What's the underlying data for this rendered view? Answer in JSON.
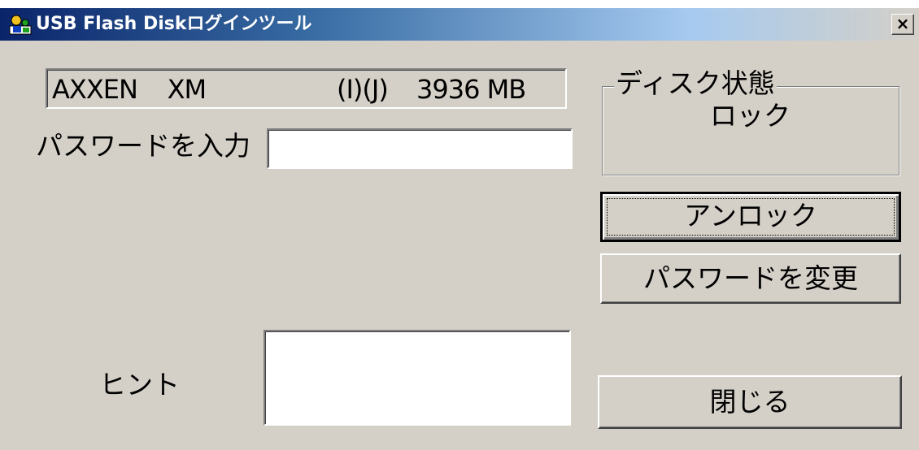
{
  "window": {
    "title": "USB Flash Diskログインツール",
    "close_label": "×"
  },
  "drive": {
    "name": "AXXEN    XM",
    "letters": "(I)(J)",
    "size": "3936 MB"
  },
  "password": {
    "label": "パスワードを入力",
    "value": ""
  },
  "hint": {
    "label": "ヒント",
    "value": ""
  },
  "disk_status": {
    "group_label": "ディスク状態",
    "status_text": "ロック"
  },
  "buttons": {
    "unlock": "アンロック",
    "change_password": "パスワードを変更",
    "close": "閉じる"
  },
  "icons": {
    "app_icon": "user-key-icon",
    "close_icon": "close-icon"
  },
  "colors": {
    "face": "#d4d0c8",
    "title_active": "#0a246a",
    "title_gradient_end": "#a6caf0"
  }
}
